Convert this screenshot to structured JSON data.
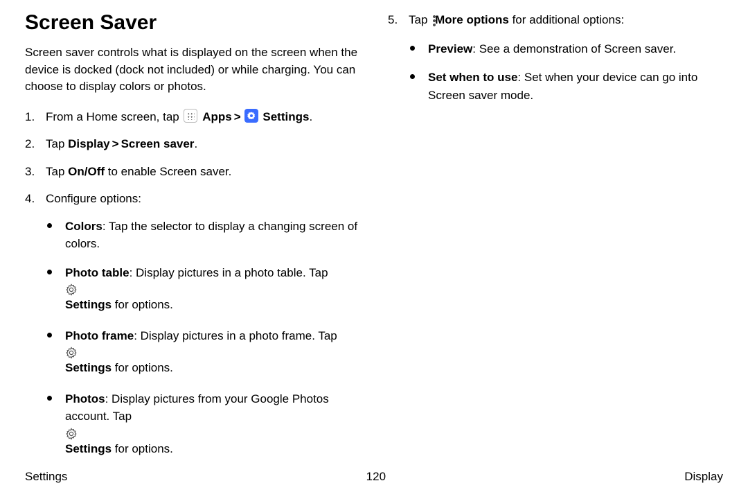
{
  "title": "Screen Saver",
  "intro": "Screen saver controls what is displayed on the screen when the device is docked (dock not included) or while charging. You can choose to display colors or photos.",
  "step1": {
    "a": "From a Home screen, tap ",
    "apps": "Apps",
    "settings": "Settings",
    "dot": "."
  },
  "step2": {
    "a": "Tap ",
    "b": "Display",
    "c": "Screen saver",
    "d": "."
  },
  "step3": {
    "a": "Tap ",
    "b": "On/Off",
    "c": " to enable Screen saver."
  },
  "step4": {
    "a": "Configure options:",
    "bullets": {
      "b1a": "Colors",
      "b1b": ": Tap the selector to display a changing screen of colors.",
      "b2a": "Photo table",
      "b2b": ": Display pictures in a photo table. Tap ",
      "b2c": "Settings",
      "b2d": " for options.",
      "b3a": "Photo frame",
      "b3b": ": Display pictures in a photo frame. Tap ",
      "b3c": "Settings",
      "b3d": " for options.",
      "b4a": "Photos",
      "b4b": ": Display pictures from your Google Photos account. Tap ",
      "b4c": "Settings",
      "b4d": " for options."
    }
  },
  "step5": {
    "a": "Tap ",
    "b": "More options",
    "c": " for additional options:",
    "bullets": {
      "b1a": "Preview",
      "b1b": ": See a demonstration of Screen saver.",
      "b2a": "Set when to use",
      "b2b": ": Set when your device can go into Screen saver mode."
    }
  },
  "chev": ">",
  "footer": {
    "left": "Settings",
    "center": "120",
    "right": "Display"
  }
}
